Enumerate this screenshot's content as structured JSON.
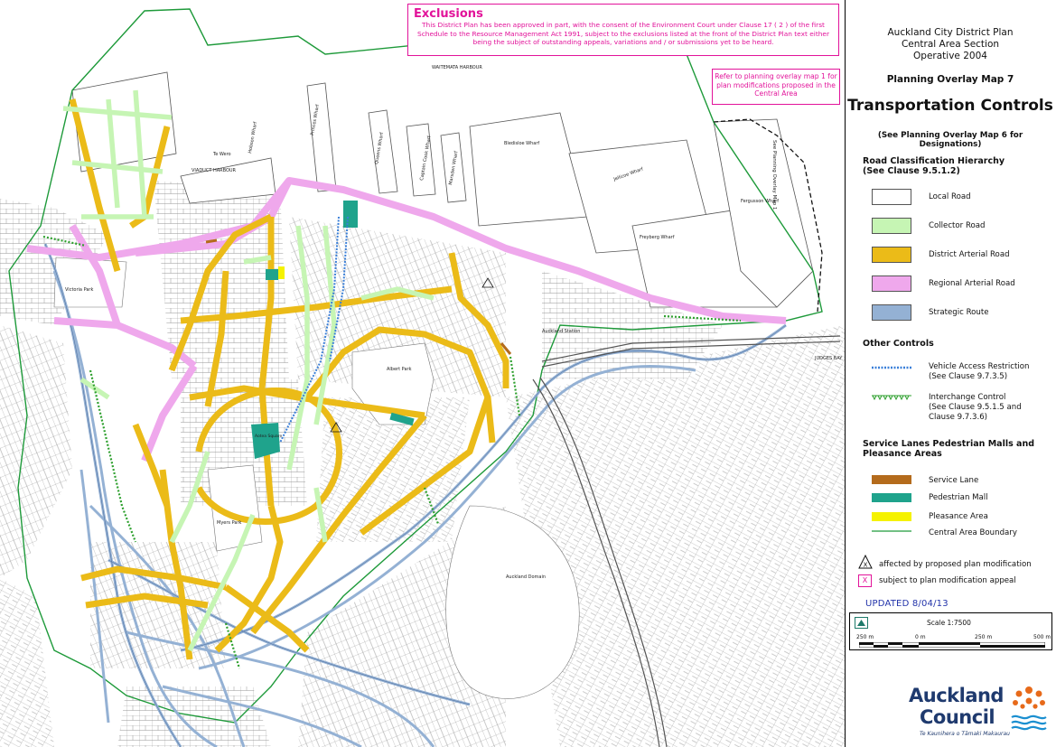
{
  "exclusions": {
    "title": "Exclusions",
    "body": "This District Plan has been approved in part, with the consent of the Environment Court under Clause 17 ( 2 ) of the first Schedule to the Resource Management Act 1991, subject to the exclusions listed at the front of the District Plan text either being the subject of outstanding appeals, variations and / or submissions yet to be heard."
  },
  "refer_note": "Refer to planning overlay map 1 for plan modifications proposed in the Central Area",
  "header": {
    "line1": "Auckland City District Plan",
    "line2": "Central Area Section",
    "line3": "Operative 2004",
    "map_number": "Planning Overlay Map 7",
    "title": "Transportation Controls",
    "subtitle": "(See Planning Overlay Map 6 for Designations)"
  },
  "road_hierarchy": {
    "heading1": "Road Classification Hierarchy",
    "heading2": "(See Clause 9.5.1.2)",
    "items": [
      {
        "label": "Local Road",
        "color": "#ffffff"
      },
      {
        "label": "Collector Road",
        "color": "#c6f5b4"
      },
      {
        "label": "District Arterial Road",
        "color": "#ebbb18"
      },
      {
        "label": "Regional Arterial Road",
        "color": "#efa8ec"
      },
      {
        "label": "Strategic Route",
        "color": "#94b1d4"
      }
    ]
  },
  "other_controls": {
    "heading": "Other Controls",
    "items": [
      {
        "label1": "Vehicle Access Restriction",
        "label2": "(See Clause 9.7.3.5)",
        "color": "#3a7fd8",
        "icon": "vehicle-access-restriction-line"
      },
      {
        "label1": "Interchange Control",
        "label2": "(See Clause 9.5.1.5 and",
        "label3": "Clause 9.7.3.6)",
        "color": "#2ea02e",
        "icon": "interchange-control-line"
      }
    ]
  },
  "service_lanes": {
    "heading1": "Service Lanes Pedestrian Malls and",
    "heading2": "Pleasance Areas",
    "items": [
      {
        "label": "Service Lane",
        "color": "#b46b1c"
      },
      {
        "label": "Pedestrian Mall",
        "color": "#1fa38c"
      },
      {
        "label": "Pleasance Area",
        "color": "#f5f200"
      },
      {
        "label": "Central Area Boundary",
        "color": "#1e9a3a"
      }
    ]
  },
  "modifications": {
    "proposed_symbol": "X",
    "proposed": "affected by proposed plan modification",
    "appeal_symbol": "X",
    "appeal": "subject to plan modification appeal"
  },
  "updated": "UPDATED 8/04/13",
  "scale": {
    "label": "Scale  1:7500",
    "ticks": [
      "250 m",
      "0 m",
      "250 m",
      "500 m"
    ]
  },
  "logo": {
    "line1": "Auckland",
    "line2": "Council",
    "tagline": "Te Kaunihera o Tāmaki Makaurau"
  },
  "map_labels": {
    "waitemata_harbour": "WAITEMATA     HARBOUR",
    "viaduct_harbour": "VIADUCT HARBOUR",
    "te_wero": "Te Wero",
    "hobson_wharf": "Hobson Wharf",
    "princes_wharf": "Princes Wharf",
    "queens_wharf": "Queens Wharf",
    "captain_cook_wharf": "Captain Cook Wharf",
    "marsden_wharf": "Marsden Wharf",
    "bledisloe_wharf": "Bledisloe Wharf",
    "jellicoe_wharf": "Jellicoe Wharf",
    "freyberg_wharf": "Freyberg Wharf",
    "fergusson_wharf": "Fergusson Wharf",
    "see_planning_overlay": "See Planning Overlay Map 1",
    "victoria_park": "Victoria Park",
    "albert_park": "Albert Park",
    "myers_park": "Myers Park",
    "auckland_domain": "Auckland Domain",
    "auckland_station": "Auckland Station",
    "judges_bay": "JUDGES BAY",
    "aotea_square": "Aotea Square"
  }
}
